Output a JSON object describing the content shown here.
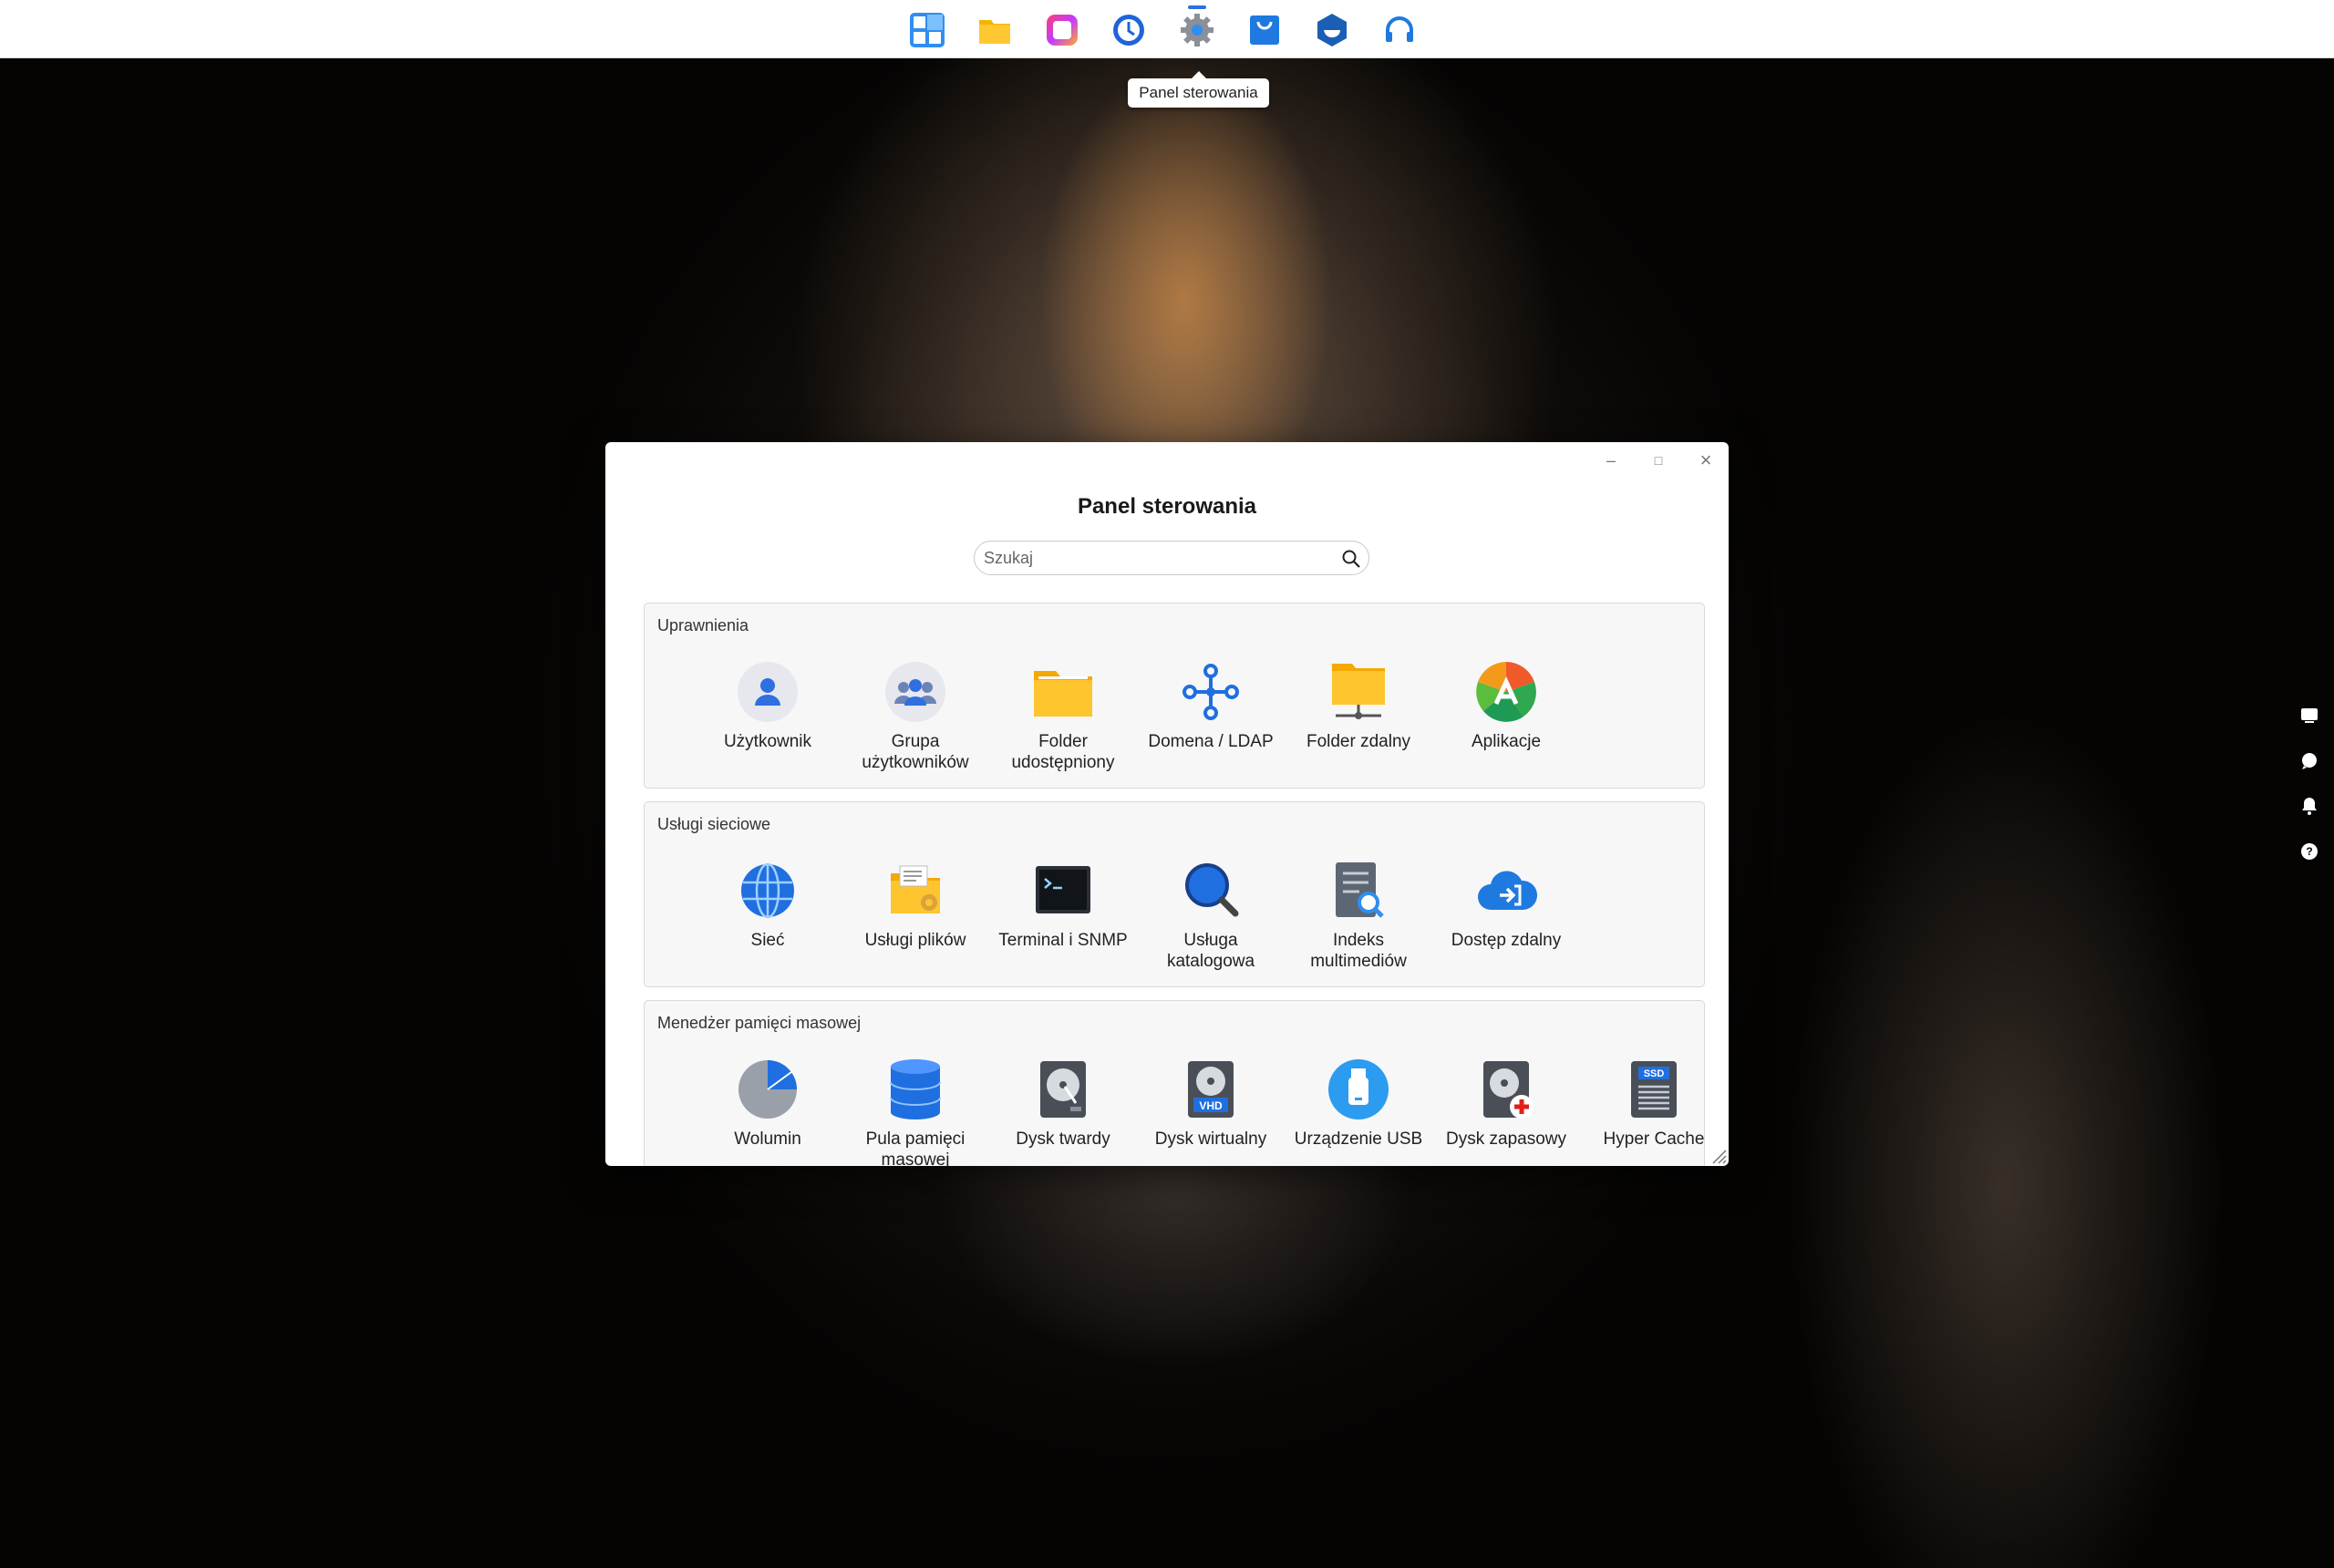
{
  "taskbar": {
    "icons": [
      {
        "name": "widgets-icon"
      },
      {
        "name": "file-manager-icon"
      },
      {
        "name": "photos-icon"
      },
      {
        "name": "backup-clock-icon"
      },
      {
        "name": "settings-gear-icon"
      },
      {
        "name": "app-center-icon"
      },
      {
        "name": "docker-icon"
      },
      {
        "name": "support-headset-icon"
      }
    ],
    "tooltip": "Panel sterowania"
  },
  "window": {
    "title": "Panel sterowania",
    "controls": {
      "minimize": "–",
      "maximize": "□",
      "close": "×"
    },
    "search": {
      "placeholder": "Szukaj"
    },
    "sections": [
      {
        "title": "Uprawnienia",
        "items": [
          {
            "label": "Użytkownik",
            "icon": "user-icon"
          },
          {
            "label": "Grupa użytkowników",
            "icon": "user-group-icon"
          },
          {
            "label": "Folder udostępniony",
            "icon": "shared-folder-icon"
          },
          {
            "label": "Domena / LDAP",
            "icon": "domain-ldap-icon"
          },
          {
            "label": "Folder zdalny",
            "icon": "remote-folder-icon"
          },
          {
            "label": "Aplikacje",
            "icon": "applications-icon"
          }
        ]
      },
      {
        "title": "Usługi sieciowe",
        "items": [
          {
            "label": "Sieć",
            "icon": "network-globe-icon"
          },
          {
            "label": "Usługi plików",
            "icon": "file-services-icon"
          },
          {
            "label": "Terminal i SNMP",
            "icon": "terminal-icon"
          },
          {
            "label": "Usługa katalogowa",
            "icon": "directory-search-icon"
          },
          {
            "label": "Indeks multimediów",
            "icon": "media-index-icon"
          },
          {
            "label": "Dostęp zdalny",
            "icon": "remote-access-cloud-icon"
          }
        ]
      },
      {
        "title": "Menedżer pamięci masowej",
        "items": [
          {
            "label": "Wolumin",
            "icon": "volume-pie-icon"
          },
          {
            "label": "Pula pamięci masowej",
            "icon": "storage-pool-icon"
          },
          {
            "label": "Dysk twardy",
            "icon": "hard-disk-icon"
          },
          {
            "label": "Dysk wirtualny",
            "icon": "virtual-disk-icon"
          },
          {
            "label": "Urządzenie USB",
            "icon": "usb-device-icon"
          },
          {
            "label": "Dysk zapasowy",
            "icon": "spare-disk-icon"
          },
          {
            "label": "Hyper Cache",
            "icon": "hyper-cache-ssd-icon"
          }
        ]
      }
    ]
  },
  "colors": {
    "accent": "#2f6fe0",
    "folder": "#f7b500"
  }
}
